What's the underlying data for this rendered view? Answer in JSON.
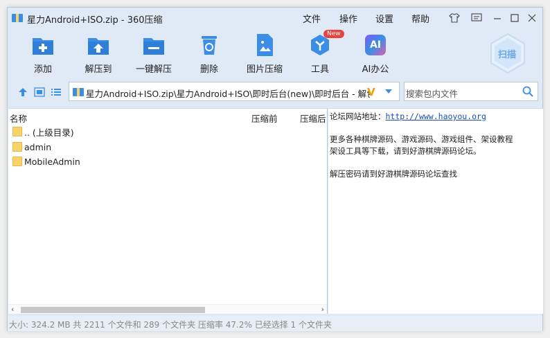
{
  "titlebar": {
    "title": "星力Android+ISO.zip - 360压缩",
    "menu": [
      "文件",
      "操作",
      "设置",
      "帮助"
    ]
  },
  "toolbar": {
    "items": [
      {
        "label": "添加",
        "icon": "add-icon"
      },
      {
        "label": "解压到",
        "icon": "extract-to-icon"
      },
      {
        "label": "一键解压",
        "icon": "one-click-extract-icon"
      },
      {
        "label": "删除",
        "icon": "delete-icon"
      },
      {
        "label": "图片压缩",
        "icon": "image-compress-icon"
      },
      {
        "label": "工具",
        "icon": "tools-icon",
        "badge": "New"
      },
      {
        "label": "AI办公",
        "icon": "ai-office-icon",
        "icon_text": "AI"
      }
    ],
    "scan_label": "扫描"
  },
  "address": {
    "path": "星力Android+ISO.zip\\星力Android+ISO\\即时后台(new)\\即时后台 - 解包文",
    "search_placeholder": "搜索包内文件"
  },
  "filelist": {
    "columns": [
      "名称",
      "压缩前",
      "压缩后"
    ],
    "rows": [
      {
        "name": ".. (上级目录)"
      },
      {
        "name": "admin"
      },
      {
        "name": "MobileAdmin"
      }
    ]
  },
  "info": {
    "site_label": "论坛网站地址：",
    "site_url": "http://www.haoyou.org",
    "line2": "更多各种棋牌源码、游戏源码、游戏组件、架设教程",
    "line3": "架设工具等下载，请到好游棋牌源码论坛。",
    "line4": "解压密码请到好游棋牌源码论坛查找"
  },
  "status": {
    "text": "大小: 324.2 MB 共 2211 个文件和 289 个文件夹 压缩率 47.2% 已经选择 1 个文件夹"
  },
  "colors": {
    "accent": "#3a8ee6",
    "window_bg": "#dfeaf6",
    "folder": "#f8d36a"
  }
}
